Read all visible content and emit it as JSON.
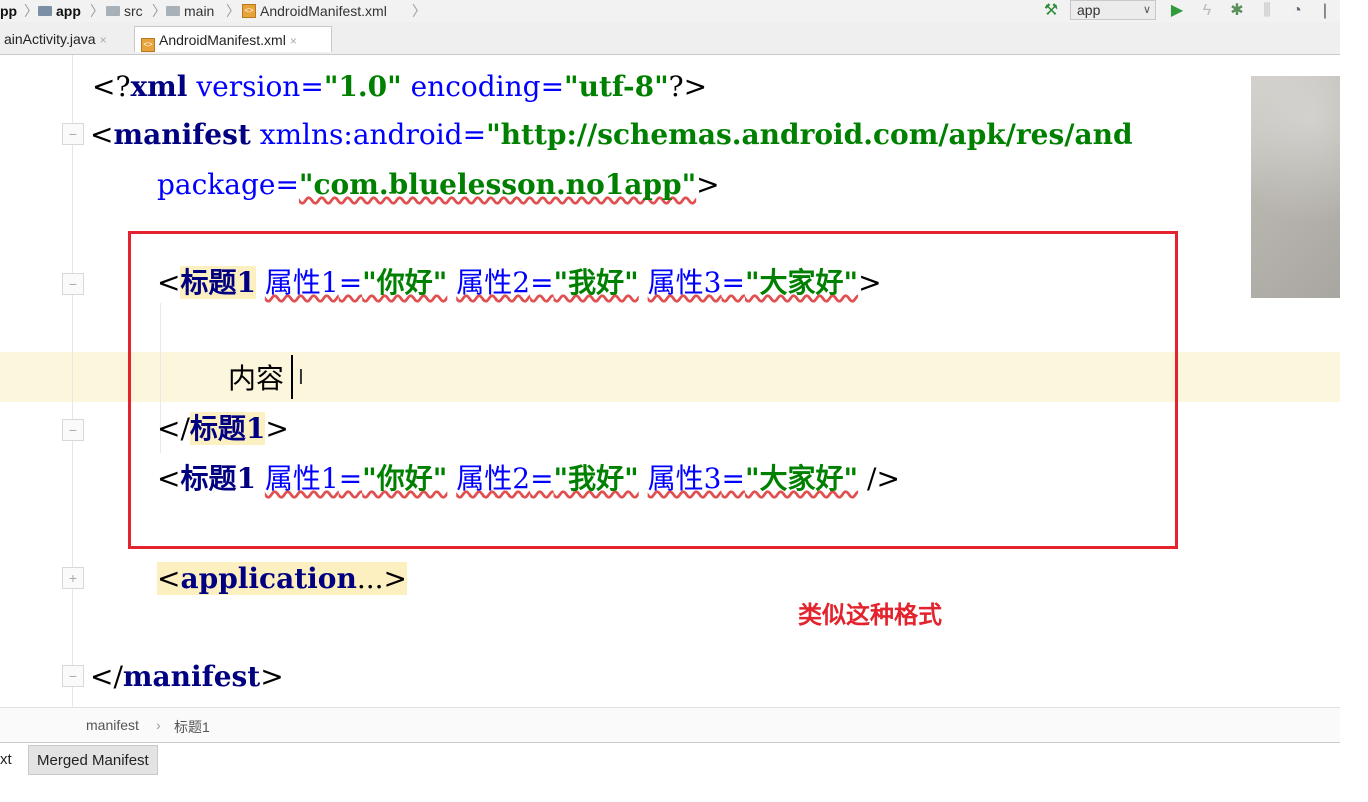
{
  "breadcrumbs": [
    "pp",
    "app",
    "src",
    "main",
    "AndroidManifest.xml"
  ],
  "toolbar": {
    "run_config": "app"
  },
  "tabs": [
    {
      "label": "ainActivity.java",
      "close": "×"
    },
    {
      "label": "AndroidManifest.xml",
      "close": "×"
    }
  ],
  "code": {
    "line1": {
      "open": "<?",
      "kw": "xml",
      "a1": " version=",
      "v1": "\"1.0\"",
      "a2": " encoding=",
      "v2": "\"utf-8\"",
      "close": "?>"
    },
    "line2": {
      "open": "<",
      "kw": "manifest",
      "a1": " xmlns:android=",
      "v1": "\"http://schemas.android.com/apk/res/and"
    },
    "line3": {
      "a1": "package=",
      "v1": "\"com.bluelesson.no1app\"",
      "close": ">"
    },
    "line5": {
      "open": "<",
      "kw": "标题1",
      "a1": "属性1",
      "eq1": "=",
      "v1": "\"你好\"",
      "a2": "属性2",
      "eq2": "=",
      "v2": "\"我好\"",
      "a3": "属性3",
      "eq3": "=",
      "v3": "\"大家好\"",
      "close": ">"
    },
    "line7": {
      "text": "内容"
    },
    "line8": {
      "open": "</",
      "kw": "标题1",
      "close": ">"
    },
    "line9": {
      "open": "<",
      "kw": "标题1",
      "a1": "属性1",
      "eq1": "=",
      "v1": "\"你好\"",
      "a2": "属性2",
      "eq2": "=",
      "v2": "\"我好\"",
      "a3": "属性3",
      "eq3": "=",
      "v3": "\"大家好\"",
      "close": " />"
    },
    "line11": {
      "open": "<",
      "kw": "application",
      "dots": "...",
      "close": ">"
    },
    "line13": {
      "open": "</",
      "kw": "manifest",
      "close": ">"
    }
  },
  "annotation": "类似这种格式",
  "footer_breadcrumbs": [
    "manifest",
    "标题1"
  ],
  "footer_sep": "›",
  "bottom_tabs": [
    "xt",
    "Merged Manifest"
  ],
  "colors": {
    "highlight_box": "#e3232e",
    "caret_row": "#fcf6dc"
  }
}
